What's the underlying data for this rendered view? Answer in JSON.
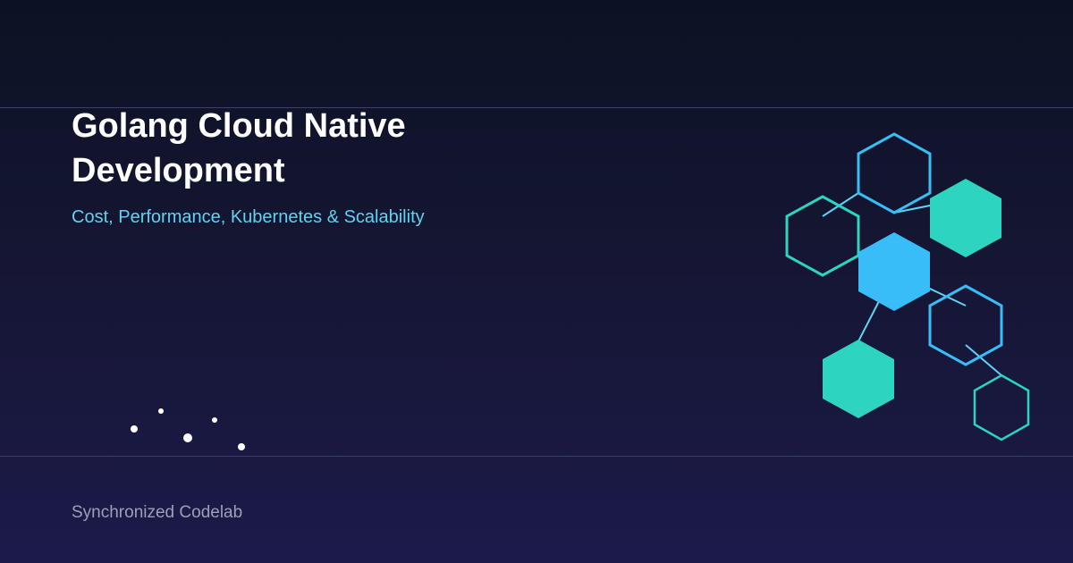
{
  "card": {
    "title_line_1": "Golang Cloud Native",
    "title_line_2": "Development",
    "subtitle": "Cost, Performance, Kubernetes & Scalability",
    "footer": "Synchronized Codelab"
  },
  "colors": {
    "background_top": "#0c1223",
    "background_bottom": "#1c1a4a",
    "title": "#ffffff",
    "subtitle": "#5fd3f3",
    "footer": "#9aa0b8",
    "hex_teal": "#2dd4bf",
    "hex_blue": "#38bdf8",
    "rule": "#3a3f6b"
  }
}
